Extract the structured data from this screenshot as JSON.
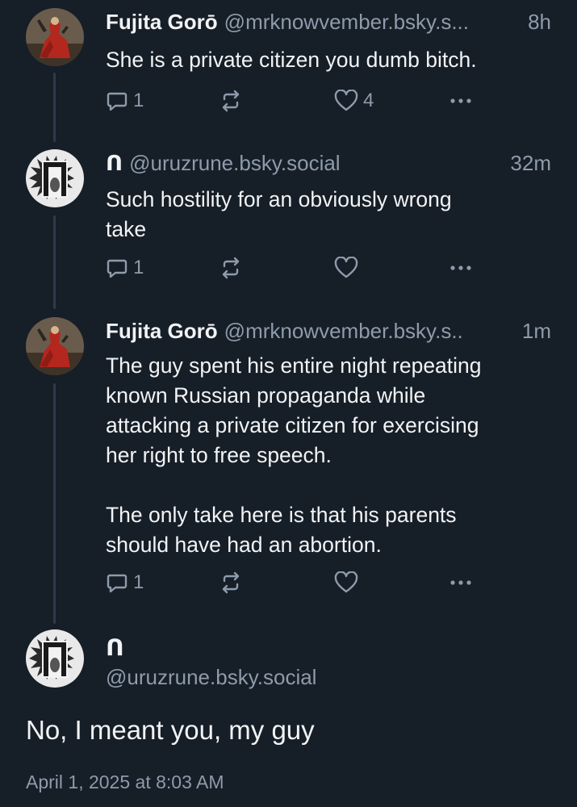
{
  "thread": {
    "posts": [
      {
        "name": "Fujita Gorō",
        "handle": "@mrknowvember.bsky.s...",
        "time": "8h",
        "text": "She is a private citizen you dumb bitch.",
        "reply_count": "1",
        "like_count": "4",
        "avatar": "red-robed-figure-avatar"
      },
      {
        "name": "ᑎ",
        "handle": "@uruzrune.bsky.social",
        "time": "32m",
        "text": "Such hostility for an obviously wrong\ntake",
        "reply_count": "1",
        "like_count": "",
        "avatar": "rune-bull-avatar"
      },
      {
        "name": "Fujita Gorō",
        "handle": "@mrknowvember.bsky.s..",
        "time": "1m",
        "text": "The guy spent his entire night repeating\nknown Russian propaganda while\nattacking a private citizen for exercising\nher right to free speech.\n\nThe only take here is that his parents\nshould have had an abortion.",
        "reply_count": "1",
        "like_count": "",
        "avatar": "red-robed-figure-avatar"
      }
    ]
  },
  "main_post": {
    "name": "ᑎ",
    "handle": "@uruzrune.bsky.social",
    "text": "No, I meant you, my guy",
    "date": "April 1, 2025 at 8:03 AM",
    "avatar": "rune-bull-avatar"
  },
  "colors": {
    "background": "#161e27",
    "text": "#f1f3f5",
    "muted": "#8e9bab",
    "thread_line": "#2e3b4b"
  }
}
